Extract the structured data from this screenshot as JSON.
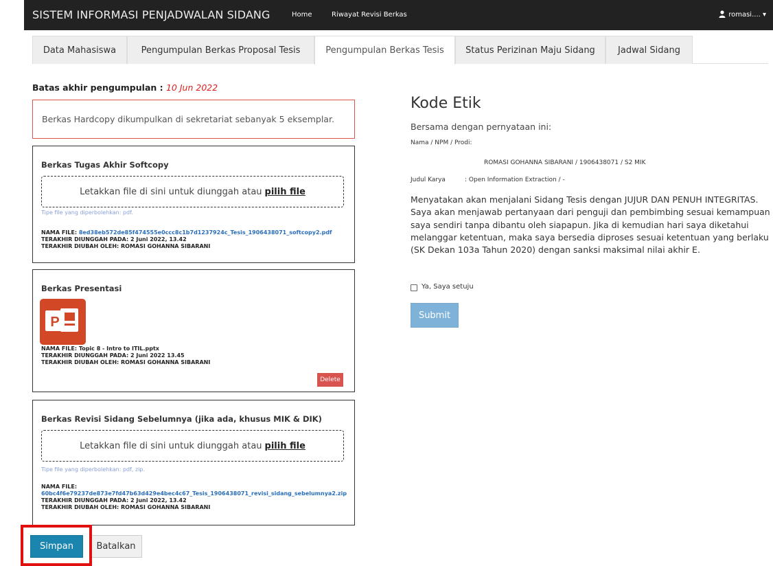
{
  "navbar": {
    "brand": "SISTEM INFORMASI PENJADWALAN SIDANG",
    "links": [
      "Home",
      "Riwayat Revisi Berkas"
    ],
    "user": "romasi.... ▾"
  },
  "tabs": [
    "Data Mahasiswa",
    "Pengumpulan Berkas Proposal Tesis",
    "Pengumpulan Berkas Tesis",
    "Status Perizinan Maju Sidang",
    "Jadwal Sidang"
  ],
  "deadline": {
    "label": "Batas akhir pengumpulan : ",
    "date": "10 Jun 2022"
  },
  "notice": "Berkas Hardcopy dikumpulkan di sekretariat sebanyak 5 eksemplar.",
  "panels": {
    "softcopy": {
      "title": "Berkas Tugas Akhir Softcopy",
      "drop_text": "Letakkan file di sini untuk diunggah atau",
      "pick_text": "pilih file",
      "filetype": "Tipe file yang diperbolehkan: pdf.",
      "file_label": "NAMA FILE: ",
      "file_name": "8ed38eb572de85f474555e0ccc8c1b7d1237924c_Tesis_1906438071_softcopy2.pdf",
      "uploaded": "TERAKHIR DIUNGGAH PADA: 2 Juni 2022, 13.42",
      "changed_by": "TERAKHIR DIUBAH OLEH: ROMASI GOHANNA SIBARANI"
    },
    "presentasi": {
      "title": "Berkas Presentasi",
      "icon_letter": "P",
      "file_name": "NAMA FILE: Topic 8 - Intro to ITIL.pptx",
      "uploaded": "TERAKHIR DIUNGGAH PADA: 2 Juni 2022 13.45",
      "changed_by": "TERAKHIR DIUBAH OLEH: ROMASI GOHANNA SIBARANI",
      "delete_label": "Delete"
    },
    "revisi": {
      "title": "Berkas Revisi Sidang Sebelumnya (jika ada, khusus MIK & DIK)",
      "drop_text": "Letakkan file di sini untuk diunggah atau",
      "pick_text": "pilih file",
      "filetype": "Tipe file yang diperbolehkan: pdf, zip.",
      "file_label": "NAMA FILE:",
      "file_name": "60bc4f6e79237de873e7fd47b63d429e4bec4c67_Tesis_1906438071_revisi_sidang_sebelumnya2.zip",
      "uploaded": "TERAKHIR DIUNGGAH PADA: 2 Juni 2022, 13.42",
      "changed_by": "TERAKHIR DIUBAH OLEH: ROMASI GOHANNA SIBARANI"
    }
  },
  "buttons": {
    "save": "Simpan",
    "cancel": "Batalkan"
  },
  "kode_etik": {
    "title": "Kode Etik",
    "intro": "Bersama dengan pernyataan ini:",
    "nama_label": "Nama / NPM / Prodi:",
    "nama_value": "ROMASI GOHANNA SIBARANI / 1906438071 / S2 MIK",
    "judul_label": "Judul Karya",
    "judul_value": ": Open Information Extraction / -",
    "statement": "Menyatakan akan menjalani Sidang Tesis dengan JUJUR DAN PENUH INTEGRITAS. Saya akan menjawab pertanyaan dari penguji dan pembimbing sesuai kemampuan saya sendiri tanpa dibantu oleh siapapun. Jika di kemudian hari saya diketahui melanggar ketentuan, maka saya bersedia diproses sesuai ketentuan yang berlaku (SK Dekan 103a Tahun 2020) dengan sanksi maksimal nilai akhir E.",
    "agree_label": "Ya, Saya setuju",
    "submit": "Submit"
  }
}
